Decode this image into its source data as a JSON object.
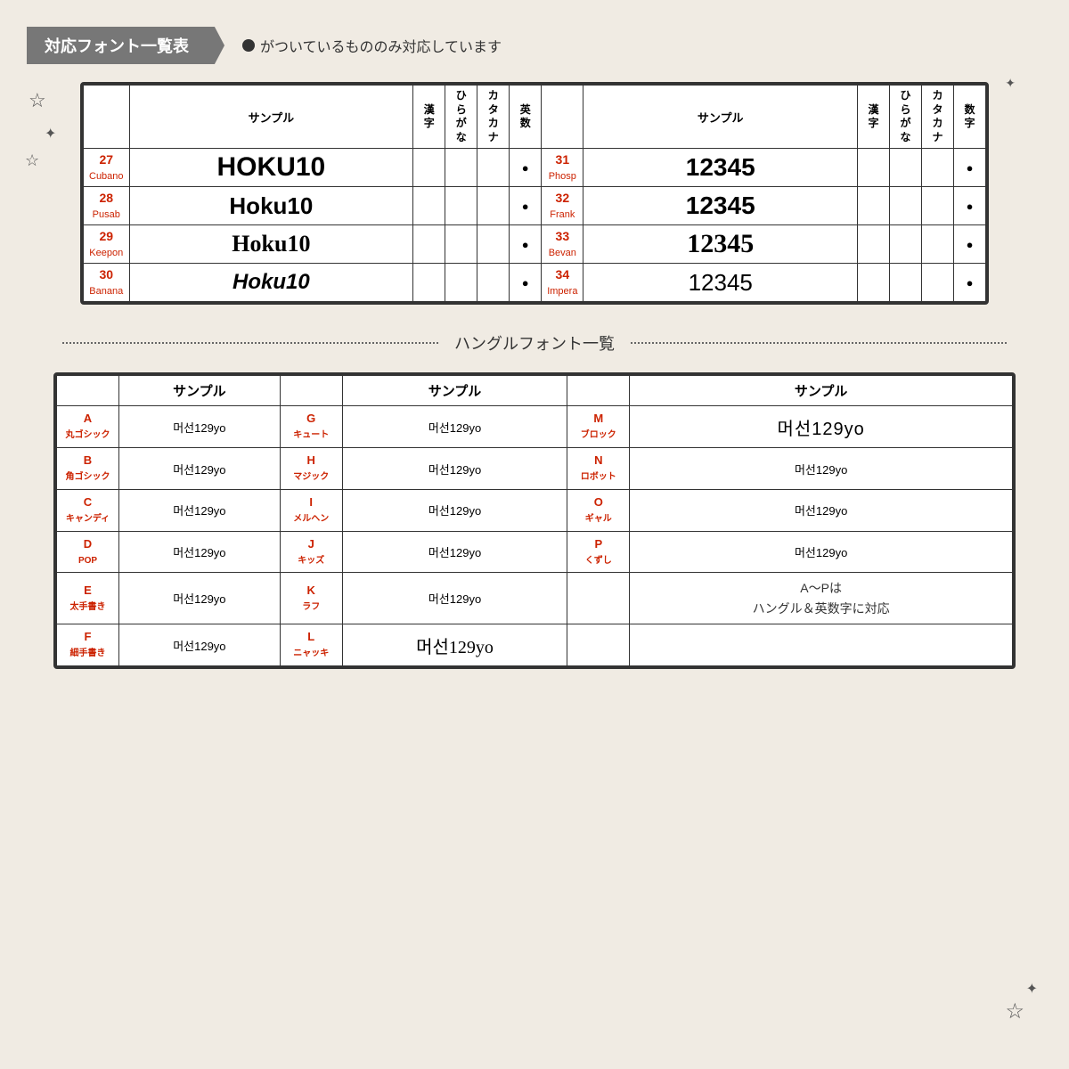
{
  "header": {
    "title": "対応フォント一覧表",
    "note_prefix": "●",
    "note_text": " がついているもののみ対応しています"
  },
  "top_table": {
    "headers_left": [
      "",
      "サンプル",
      "漢字",
      "ひらがな",
      "カタカナ",
      "英数"
    ],
    "headers_right": [
      "",
      "サンプル",
      "漢字",
      "ひらがな",
      "カタカナ",
      "数字"
    ],
    "rows": [
      {
        "id": "27",
        "name": "Cubano",
        "sample": "HOKU10",
        "style": "cubano",
        "kanji": "",
        "hira": "",
        "kata": "",
        "eisuu": "●",
        "r_id": "31",
        "r_name": "Phosp",
        "r_sample": "12345",
        "r_style": "phosphor",
        "r_kanji": "",
        "r_hira": "",
        "r_kata": "",
        "r_suu": "●"
      },
      {
        "id": "28",
        "name": "Pusab",
        "sample": "Hoku10",
        "style": "pusab",
        "kanji": "",
        "hira": "",
        "kata": "",
        "eisuu": "●",
        "r_id": "32",
        "r_name": "Frank",
        "r_sample": "12345",
        "r_style": "frank",
        "r_kanji": "",
        "r_hira": "",
        "r_kata": "",
        "r_suu": "●"
      },
      {
        "id": "29",
        "name": "Keepon",
        "sample": "Hoku10",
        "style": "keepon",
        "kanji": "",
        "hira": "",
        "kata": "",
        "eisuu": "●",
        "r_id": "33",
        "r_name": "Bevan",
        "r_sample": "12345",
        "r_style": "bevan",
        "r_kanji": "",
        "r_hira": "",
        "r_kata": "",
        "r_suu": "●"
      },
      {
        "id": "30",
        "name": "Banana",
        "sample": "Hoku10",
        "style": "banana",
        "kanji": "",
        "hira": "",
        "kata": "",
        "eisuu": "●",
        "r_id": "34",
        "r_name": "Impera",
        "r_sample": "12345",
        "r_style": "impera",
        "r_kanji": "",
        "r_hira": "",
        "r_kata": "",
        "r_suu": "●"
      }
    ]
  },
  "divider": {
    "text": "ハングルフォント一覧"
  },
  "hangul_table": {
    "col_headers": [
      "",
      "サンプル",
      "",
      "サンプル",
      "",
      "サンプル"
    ],
    "rows": [
      {
        "a_label": "A",
        "a_sub": "丸ゴシック",
        "a_sample": "머선129yo",
        "a_style": "maru",
        "g_label": "G",
        "g_sub": "キュート",
        "g_sample": "머선129yo",
        "g_style": "cute",
        "m_label": "M",
        "m_sub": "ブロック",
        "m_sample": "머선129yo",
        "m_style": "block"
      },
      {
        "a_label": "B",
        "a_sub": "角ゴシック",
        "a_sample": "머선129yo",
        "a_style": "kaku",
        "g_label": "H",
        "g_sub": "マジック",
        "g_sample": "머선129yo",
        "g_style": "magic",
        "m_label": "N",
        "m_sub": "ロボット",
        "m_sample": "머선129yo",
        "m_style": "robot"
      },
      {
        "a_label": "C",
        "a_sub": "キャンディ",
        "a_sample": "머선129yo",
        "a_style": "candy",
        "g_label": "I",
        "g_sub": "メルヘン",
        "g_sample": "머선129yo",
        "g_style": "meru",
        "m_label": "O",
        "m_sub": "ギャル",
        "m_sample": "머선129yo",
        "m_style": "gyal"
      },
      {
        "a_label": "D",
        "a_sub": "POP",
        "a_sample": "머선129yo",
        "a_style": "pop",
        "g_label": "J",
        "g_sub": "キッズ",
        "g_sample": "머선129yo",
        "g_style": "kids",
        "m_label": "P",
        "m_sub": "くずし",
        "m_sample": "머선129yo",
        "m_style": "kuzushi"
      },
      {
        "a_label": "E",
        "a_sub": "太手書き",
        "a_sample": "머선129yo",
        "a_style": "thick",
        "g_label": "K",
        "g_sub": "ラフ",
        "g_sample": "머선129yo",
        "g_style": "rafu",
        "m_label": "",
        "m_sub": "",
        "m_sample": "A〜Pは\nハングル＆英数字に対応",
        "m_style": "note"
      },
      {
        "a_label": "F",
        "a_sub": "細手書き",
        "a_sample": "머선129yo",
        "a_style": "thin",
        "g_label": "L",
        "g_sub": "ニャッキ",
        "g_sample": "머선129yo",
        "g_style": "nyaki",
        "m_label": "",
        "m_sub": "",
        "m_sample": "",
        "m_style": "empty"
      }
    ]
  }
}
